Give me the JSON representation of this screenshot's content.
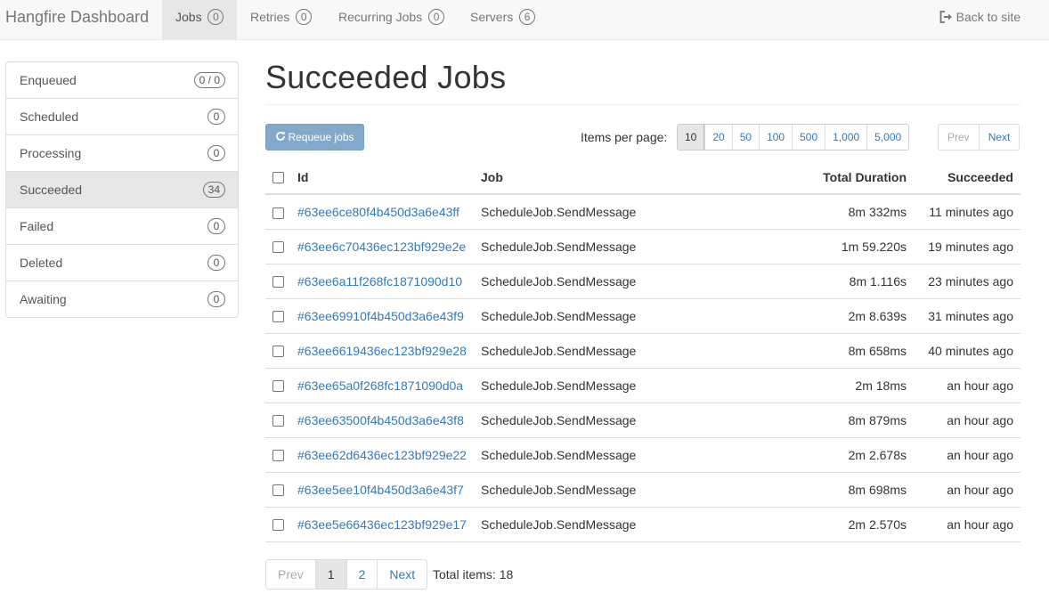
{
  "navbar": {
    "brand": "Hangfire Dashboard",
    "items": [
      {
        "label": "Jobs",
        "badge": "0"
      },
      {
        "label": "Retries",
        "badge": "0"
      },
      {
        "label": "Recurring Jobs",
        "badge": "0"
      },
      {
        "label": "Servers",
        "badge": "6"
      }
    ],
    "back_label": "Back to site",
    "back_icon": "sign-out-icon"
  },
  "sidebar": {
    "items": [
      {
        "label": "Enqueued",
        "badge": "0 / 0"
      },
      {
        "label": "Scheduled",
        "badge": "0"
      },
      {
        "label": "Processing",
        "badge": "0"
      },
      {
        "label": "Succeeded",
        "badge": "34"
      },
      {
        "label": "Failed",
        "badge": "0"
      },
      {
        "label": "Deleted",
        "badge": "0"
      },
      {
        "label": "Awaiting",
        "badge": "0"
      }
    ]
  },
  "main": {
    "title": "Succeeded Jobs",
    "requeue_label": "Requeue jobs",
    "requeue_icon": "refresh-icon",
    "items_per_page_label": "Items per page:",
    "page_sizes": [
      "10",
      "20",
      "50",
      "100",
      "500",
      "1,000",
      "5,000"
    ],
    "page_size_selected": "10",
    "top_pager": {
      "prev": "Prev",
      "next": "Next"
    },
    "table": {
      "columns": [
        "Id",
        "Job",
        "Total Duration",
        "Succeeded"
      ],
      "rows": [
        {
          "id": "#63ee6ce80f4b450d3a6e43ff",
          "job": "ScheduleJob.SendMessage",
          "duration": "8m 332ms",
          "succeeded": "11 minutes ago"
        },
        {
          "id": "#63ee6c70436ec123bf929e2e",
          "job": "ScheduleJob.SendMessage",
          "duration": "1m 59.220s",
          "succeeded": "19 minutes ago"
        },
        {
          "id": "#63ee6a11f268fc1871090d10",
          "job": "ScheduleJob.SendMessage",
          "duration": "8m 1.116s",
          "succeeded": "23 minutes ago"
        },
        {
          "id": "#63ee69910f4b450d3a6e43f9",
          "job": "ScheduleJob.SendMessage",
          "duration": "2m 8.639s",
          "succeeded": "31 minutes ago"
        },
        {
          "id": "#63ee6619436ec123bf929e28",
          "job": "ScheduleJob.SendMessage",
          "duration": "8m 658ms",
          "succeeded": "40 minutes ago"
        },
        {
          "id": "#63ee65a0f268fc1871090d0a",
          "job": "ScheduleJob.SendMessage",
          "duration": "2m 18ms",
          "succeeded": "an hour ago"
        },
        {
          "id": "#63ee63500f4b450d3a6e43f8",
          "job": "ScheduleJob.SendMessage",
          "duration": "8m 879ms",
          "succeeded": "an hour ago"
        },
        {
          "id": "#63ee62d6436ec123bf929e22",
          "job": "ScheduleJob.SendMessage",
          "duration": "2m 2.678s",
          "succeeded": "an hour ago"
        },
        {
          "id": "#63ee5ee10f4b450d3a6e43f7",
          "job": "ScheduleJob.SendMessage",
          "duration": "8m 698ms",
          "succeeded": "an hour ago"
        },
        {
          "id": "#63ee5e66436ec123bf929e17",
          "job": "ScheduleJob.SendMessage",
          "duration": "2m 2.570s",
          "succeeded": "an hour ago"
        }
      ]
    },
    "bottom_pager": {
      "prev": "Prev",
      "pages": [
        "1",
        "2"
      ],
      "current": "1",
      "next": "Next"
    },
    "total_items": "Total items: 18"
  }
}
